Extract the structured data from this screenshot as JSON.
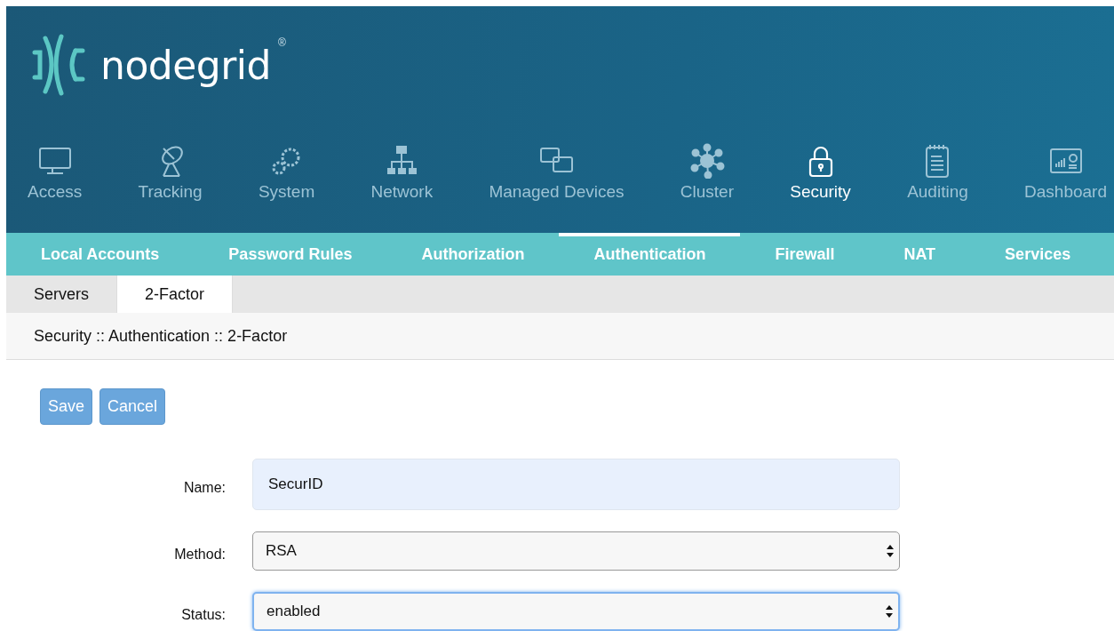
{
  "logo": {
    "name": "nodegrid",
    "mark": "®"
  },
  "main_nav": [
    {
      "label": "Access",
      "selected": false
    },
    {
      "label": "Tracking",
      "selected": false
    },
    {
      "label": "System",
      "selected": false
    },
    {
      "label": "Network",
      "selected": false
    },
    {
      "label": "Managed Devices",
      "selected": false
    },
    {
      "label": "Cluster",
      "selected": false
    },
    {
      "label": "Security",
      "selected": true
    },
    {
      "label": "Auditing",
      "selected": false
    },
    {
      "label": "Dashboard",
      "selected": false
    }
  ],
  "sub_nav": [
    {
      "label": "Local Accounts",
      "selected": false
    },
    {
      "label": "Password Rules",
      "selected": false
    },
    {
      "label": "Authorization",
      "selected": false
    },
    {
      "label": "Authentication",
      "selected": true
    },
    {
      "label": "Firewall",
      "selected": false
    },
    {
      "label": "NAT",
      "selected": false
    },
    {
      "label": "Services",
      "selected": false
    }
  ],
  "tabs": [
    {
      "label": "Servers",
      "selected": false
    },
    {
      "label": "2-Factor",
      "selected": true
    }
  ],
  "breadcrumb": "Security :: Authentication :: 2-Factor",
  "buttons": [
    "Save",
    "Cancel"
  ],
  "form": [
    {
      "label": "Name:",
      "kind": "text",
      "value": "SecurID",
      "focused": false
    },
    {
      "label": "Method:",
      "kind": "select",
      "value": "RSA",
      "focused": false
    },
    {
      "label": "Status:",
      "kind": "select",
      "value": "enabled",
      "focused": true
    }
  ]
}
